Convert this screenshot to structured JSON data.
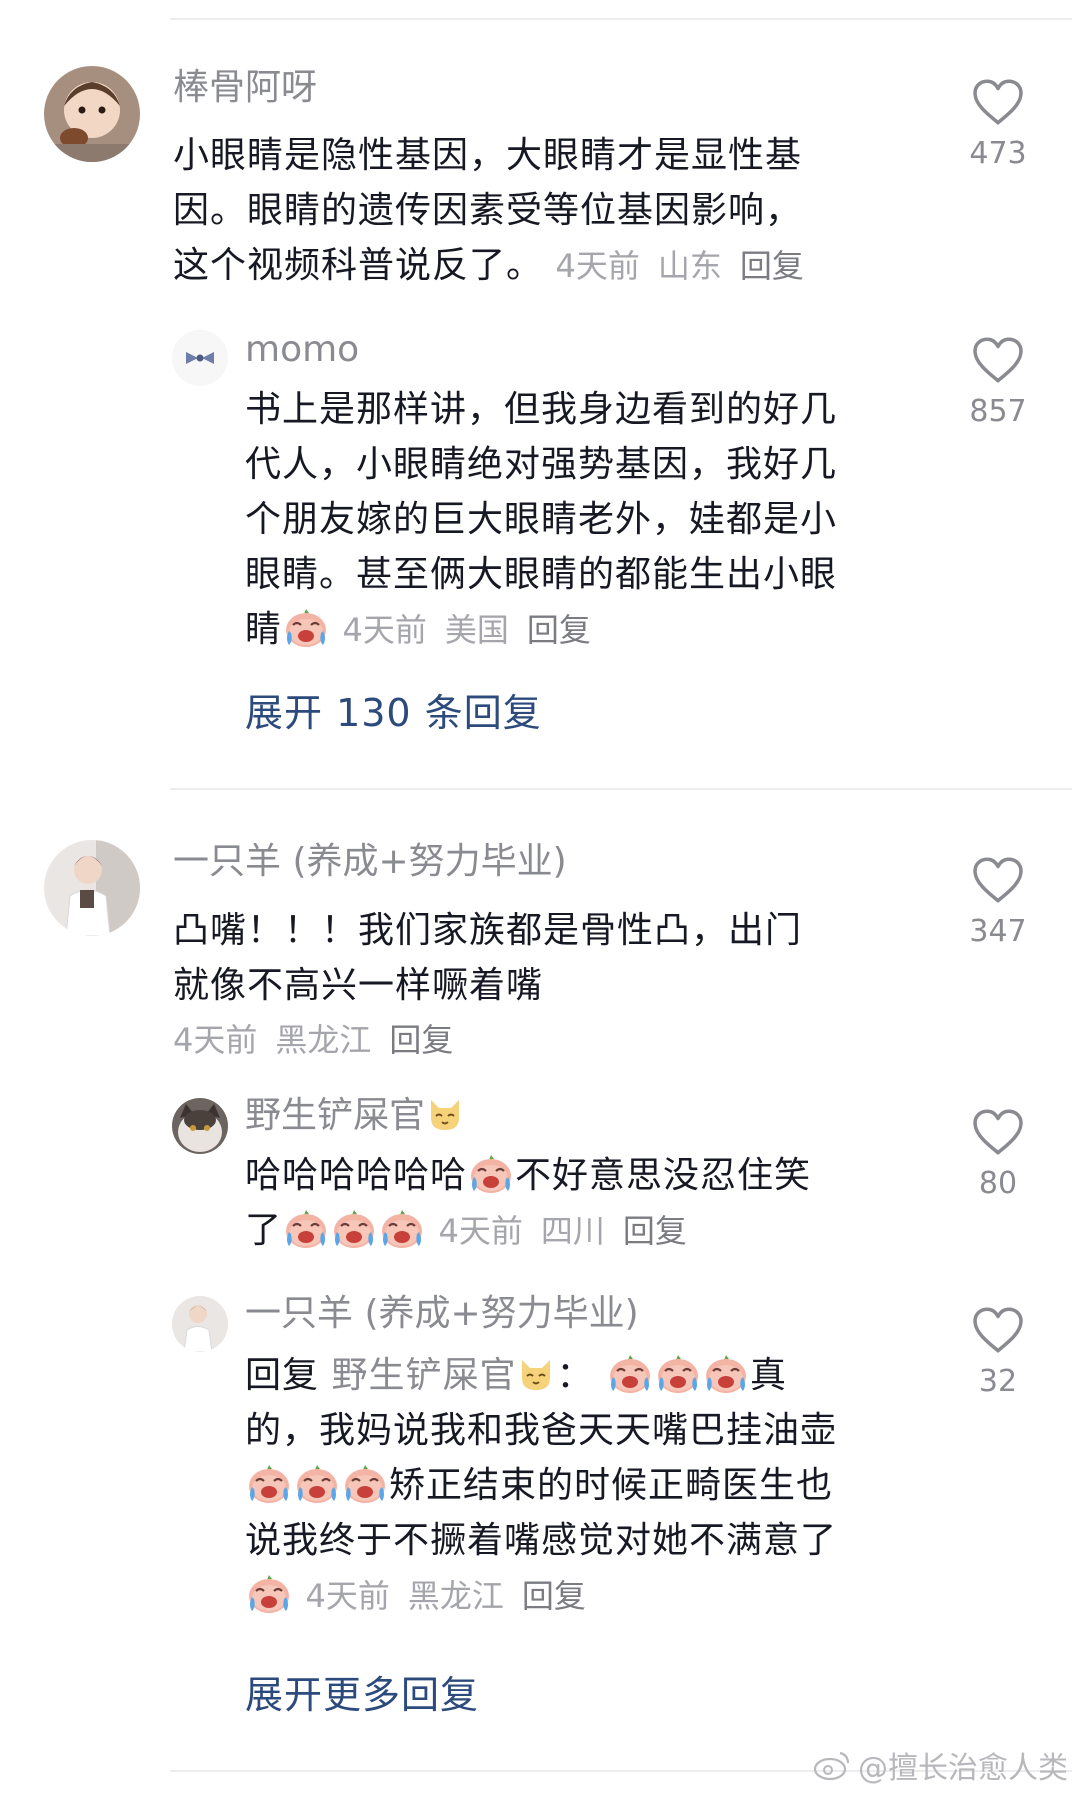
{
  "comments": [
    {
      "user": "棒骨阿呀",
      "text": "小眼睛是隐性基因，大眼睛才是显性基因。眼睛的遗传因素受等位基因影响，这个视频科普说反了。",
      "text_lines": [
        "小眼睛是隐性基因，大眼睛才是显性基",
        "因。眼睛的遗传因素受等位基因影响，",
        "这个视频科普说反了。"
      ],
      "time": "4天前",
      "location": "山东",
      "reply_label": "回复",
      "likes": "473",
      "avatar_icon": "child-photo-avatar",
      "replies": [
        {
          "user": "momo",
          "text_lines": [
            "书上是那样讲，但我身边看到的好几",
            "代人，小眼睛绝对强势基因，我好几",
            "个朋友嫁的巨大眼睛老外，娃都是小",
            "眼睛。甚至俩大眼睛的都能生出小眼",
            "睛"
          ],
          "time": "4天前",
          "location": "美国",
          "reply_label": "回复",
          "likes": "857",
          "avatar_icon": "bow-avatar"
        }
      ],
      "expand_label": "展开 130 条回复"
    },
    {
      "user": "一只羊 (养成+努力毕业)",
      "text_lines": [
        "凸嘴！！！我们家族都是骨性凸，出门",
        "就像不高兴一样噘着嘴"
      ],
      "time": "4天前",
      "location": "黑龙江",
      "reply_label": "回复",
      "likes": "347",
      "avatar_icon": "child-photo-avatar",
      "replies": [
        {
          "user": "野生铲屎官",
          "text_lines": [
            "哈哈哈哈哈哈",
            "不好意思没忍住笑",
            "了"
          ],
          "time": "4天前",
          "location": "四川",
          "reply_label": "回复",
          "likes": "80",
          "avatar_icon": "cat-photo-avatar"
        },
        {
          "user": "一只羊 (养成+努力毕业)",
          "reply_prefix": "回复",
          "mention": "野生铲屎官",
          "mention_suffix": "：",
          "text_lines": [
            "真",
            "的，我妈说我和我爸天天嘴巴挂油壶",
            "矫正结束的时候正畸医生也",
            "说我终于不撅着嘴感觉对她不满意了"
          ],
          "time": "4天前",
          "location": "黑龙江",
          "reply_label": "回复",
          "likes": "32",
          "avatar_icon": "child-photo-avatar"
        }
      ],
      "expand_label": "展开更多回复"
    }
  ],
  "icons": {
    "like": "heart-outline-icon",
    "emoji": "crying-laugh-emoji",
    "cat": "cat-face-emoji"
  },
  "watermark": "@擅长治愈人类",
  "colors": {
    "text": "#161823",
    "meta": "#a5a6ab",
    "username": "#8a8b91",
    "expand": "#2c4a7c",
    "divider": "#ececee"
  }
}
